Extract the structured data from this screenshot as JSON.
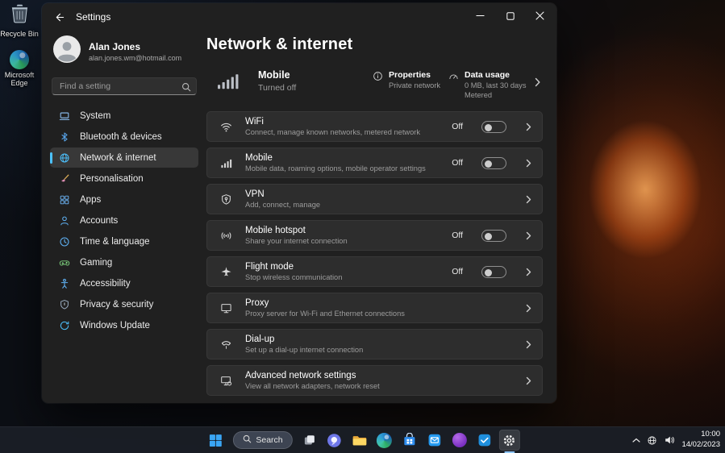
{
  "desktop": {
    "icons": [
      {
        "label": "Recycle Bin"
      },
      {
        "label": "Microsoft Edge"
      }
    ]
  },
  "window": {
    "titlebar": {
      "title": "Settings"
    },
    "profile": {
      "name": "Alan Jones",
      "email": "alan.jones.wm@hotmail.com"
    },
    "search": {
      "placeholder": "Find a setting"
    },
    "sidebar": {
      "items": [
        {
          "label": "System"
        },
        {
          "label": "Bluetooth & devices"
        },
        {
          "label": "Network & internet"
        },
        {
          "label": "Personalisation"
        },
        {
          "label": "Apps"
        },
        {
          "label": "Accounts"
        },
        {
          "label": "Time & language"
        },
        {
          "label": "Gaming"
        },
        {
          "label": "Accessibility"
        },
        {
          "label": "Privacy & security"
        },
        {
          "label": "Windows Update"
        }
      ]
    },
    "main": {
      "title": "Network & internet",
      "hero": {
        "name": "Mobile",
        "state": "Turned off",
        "properties_label": "Properties",
        "properties_value": "Private network",
        "data_usage_label": "Data usage",
        "data_usage_value": "0 MB, last 30 days",
        "data_usage_note": "Metered"
      },
      "cards": [
        {
          "title": "WiFi",
          "subtitle": "Connect, manage known networks, metered network",
          "toggle_label": "Off"
        },
        {
          "title": "Mobile",
          "subtitle": "Mobile data, roaming options, mobile operator settings",
          "toggle_label": "Off"
        },
        {
          "title": "VPN",
          "subtitle": "Add, connect, manage"
        },
        {
          "title": "Mobile hotspot",
          "subtitle": "Share your internet connection",
          "toggle_label": "Off"
        },
        {
          "title": "Flight mode",
          "subtitle": "Stop wireless communication",
          "toggle_label": "Off"
        },
        {
          "title": "Proxy",
          "subtitle": "Proxy server for Wi-Fi and Ethernet connections"
        },
        {
          "title": "Dial-up",
          "subtitle": "Set up a dial-up internet connection"
        },
        {
          "title": "Advanced network settings",
          "subtitle": "View all network adapters, network reset"
        }
      ]
    }
  },
  "taskbar": {
    "search_label": "Search",
    "clock": {
      "time": "10:00",
      "date": "14/02/2023"
    }
  },
  "colors": {
    "accent": "#4cc2ff"
  }
}
